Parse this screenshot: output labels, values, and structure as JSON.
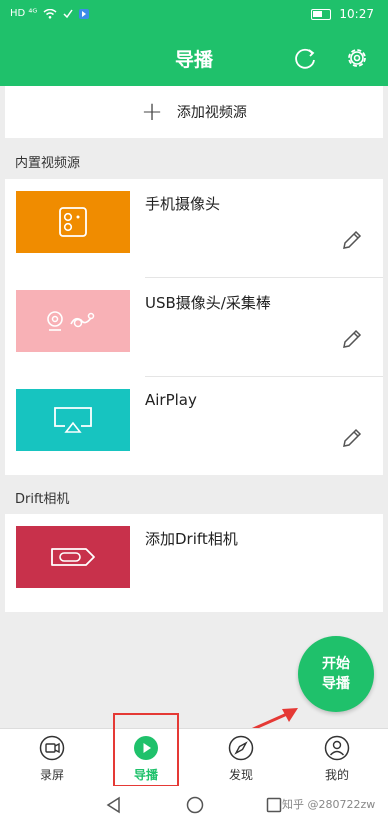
{
  "status_bar": {
    "left_indicators": "HD ⁴ᴳ",
    "time": "10:27"
  },
  "header": {
    "title": "导播",
    "refresh_icon": "refresh-icon",
    "settings_icon": "gear-icon"
  },
  "add_source": {
    "label": "添加视频源"
  },
  "builtin_section": {
    "title": "内置视频源",
    "items": [
      {
        "label": "手机摄像头",
        "thumb_color": "#f08c00"
      },
      {
        "label": "USB摄像头/采集棒",
        "thumb_color": "#f8b1b6"
      },
      {
        "label": "AirPlay",
        "thumb_color": "#17c4c0"
      }
    ]
  },
  "drift_section": {
    "title": "Drift相机",
    "items": [
      {
        "label": "添加Drift相机",
        "thumb_color": "#c8314b"
      }
    ]
  },
  "fab": {
    "line1": "开始",
    "line2": "导播"
  },
  "tabs": [
    {
      "label": "录屏",
      "icon": "record-icon"
    },
    {
      "label": "导播",
      "icon": "play-icon",
      "active": true
    },
    {
      "label": "发现",
      "icon": "compass-icon"
    },
    {
      "label": "我的",
      "icon": "profile-icon"
    }
  ],
  "colors": {
    "accent": "#1fc16b",
    "annotation": "#e53935"
  },
  "watermark": "知乎 @280722zw"
}
